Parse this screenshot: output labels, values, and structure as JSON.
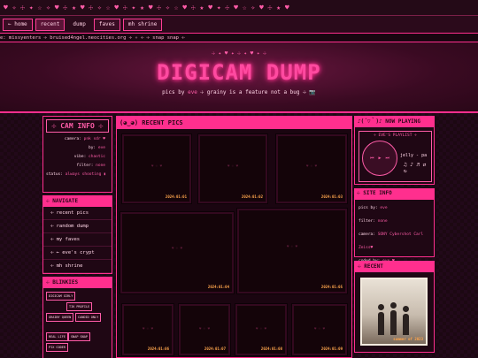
{
  "topbar": {
    "pattern": "♥ ✧ ☩ ✦ ☆ ✧ ♥ ☩ ★ ♥ ☩ ✧ ☆ ♥ ☩ ✦ ★ ♥ ☩ ✧ ☆ ♥ ☩ ★ ♥ ✦ ☩ ♥ ☆ ✧ ♥ ☩ ★ ♥"
  },
  "nav": {
    "items": [
      {
        "label": "← home",
        "state": "normal"
      },
      {
        "label": "recent",
        "state": "active"
      },
      {
        "label": "dump",
        "state": "plain"
      },
      {
        "label": "faves",
        "state": "normal"
      },
      {
        "label": "mh shrine",
        "state": "normal"
      }
    ]
  },
  "ticker": {
    "text": "e: missyenters ☩ bruised4ngel.neocities.org ☩ ✧ ☩ ☩ snap snap ☩"
  },
  "header": {
    "deco": "☩ ✦ ♥ ✦ ☩ ✦ ♥ ✦ ☩",
    "title": "DIGICAM DUMP",
    "tagline_prefix": "pics by ",
    "tagline_name": "eve",
    "tagline_suffix": " ☩ grainy is a feature not a bug ☩ 📷"
  },
  "cam_info": {
    "title": "☩ CAM INFO ☩",
    "rows": [
      {
        "label": "camera:",
        "value": "pnk sdr ♥"
      },
      {
        "label": "by:",
        "value": "eve"
      },
      {
        "label": "vibe:",
        "value": "chaotic"
      },
      {
        "label": "filter:",
        "value": "none"
      },
      {
        "label": "status:",
        "value": "always shooting ▮"
      }
    ]
  },
  "navigate": {
    "title": "☩ NAVIGATE",
    "items": [
      "☩ recent pics",
      "☩ random dump",
      "☩ my faves",
      "☩ ← eve's crypt",
      "☩ mh shrine"
    ]
  },
  "blinkies": {
    "title": "☩ BLINKIES",
    "items": [
      "DIGICAM GIRLY",
      "TIK PROFILE",
      "GRAINY QUEEN",
      "CANDID ONLY",
      "REAL LIFE",
      "SNAP SNAP",
      "PIX CODER"
    ]
  },
  "recent_pics": {
    "title": "(◕‿◕) RECENT PICS",
    "placeholder": "♥ ☩ ♥",
    "photos": [
      {
        "date": "2024:01:01"
      },
      {
        "date": "2024:01:02"
      },
      {
        "date": "2024:01:03"
      },
      {
        "date": "2024:01:04"
      },
      {
        "date": "2024:01:05"
      },
      {
        "date": "2024:01:06"
      },
      {
        "date": "2024:01:07"
      },
      {
        "date": "2024:01:08"
      },
      {
        "date": "2024:01:09"
      }
    ]
  },
  "now_playing": {
    "title": "♪(´▽｀)♪ NOW PLAYING",
    "playlist": "☩ EVE'S PLAYLIST ☩",
    "controls": "⏮ ▶ ⏭",
    "song": "jelly - pa",
    "icons": "♫ ♪ ♬ ⇄ ↻"
  },
  "site_info": {
    "title": "☩ SITE INFO",
    "rows": [
      {
        "label": "pics by:",
        "value": "eve"
      },
      {
        "label": "filter:",
        "value": "none"
      },
      {
        "label": "camera:",
        "value": "SONY Cybershot Carl"
      },
      {
        "label": "",
        "value": "Zeiss♥"
      },
      {
        "label": "coded by:",
        "value": "eve ♥"
      }
    ]
  },
  "recent": {
    "title": "☩ RECENT",
    "date": "summer of 2023"
  },
  "colors": {
    "accent": "#ff2f8e",
    "bg": "#1c0812",
    "date": "#ffa64d"
  }
}
